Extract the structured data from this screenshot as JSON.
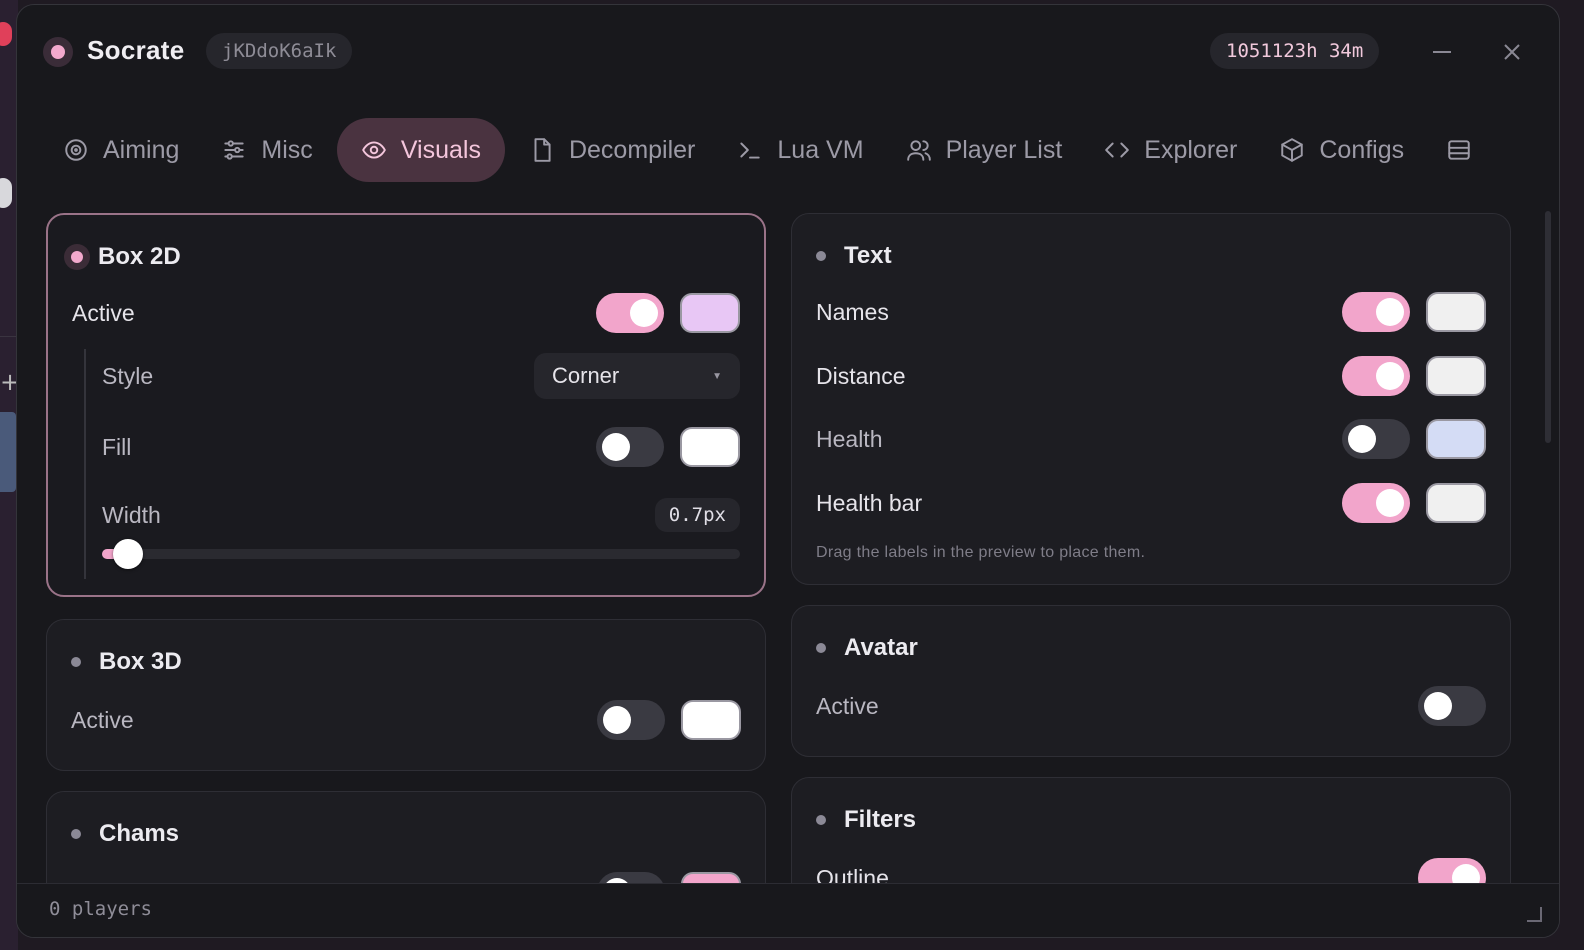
{
  "window": {
    "title": "Socrate",
    "session_id": "jKDdoK6aIk",
    "timer": "1051123h 34m",
    "minimize_glyph": "—",
    "close_glyph": "✕"
  },
  "tabs": [
    {
      "label": "Aiming",
      "icon": "target-icon"
    },
    {
      "label": "Misc",
      "icon": "sliders-icon"
    },
    {
      "label": "Visuals",
      "icon": "eye-icon",
      "active": true
    },
    {
      "label": "Decompiler",
      "icon": "file-icon"
    },
    {
      "label": "Lua VM",
      "icon": "terminal-icon"
    },
    {
      "label": "Player List",
      "icon": "users-icon"
    },
    {
      "label": "Explorer",
      "icon": "code-icon"
    },
    {
      "label": "Configs",
      "icon": "box-icon"
    }
  ],
  "box2d": {
    "title": "Box 2D",
    "active_label": "Active",
    "active_on": true,
    "active_color": "#e8c7f5",
    "style_label": "Style",
    "style_value": "Corner",
    "fill_label": "Fill",
    "fill_on": false,
    "fill_color": "#ffffff",
    "width_label": "Width",
    "width_value": "0.7px",
    "width_fraction": 0.04
  },
  "box3d": {
    "title": "Box 3D",
    "active_label": "Active",
    "active_on": false,
    "active_color": "#ffffff"
  },
  "chams": {
    "title": "Chams",
    "active_color": "#f2a5cb"
  },
  "text": {
    "title": "Text",
    "rows": [
      {
        "label": "Names",
        "on": true,
        "color": "#f0f0f0"
      },
      {
        "label": "Distance",
        "on": true,
        "color": "#f0f0f0"
      },
      {
        "label": "Health",
        "on": false,
        "color": "#d4dcf5"
      },
      {
        "label": "Health bar",
        "on": true,
        "color": "#f0f0f0"
      }
    ],
    "hint": "Drag the labels in the preview to place them."
  },
  "avatar": {
    "title": "Avatar",
    "active_label": "Active",
    "active_on": false
  },
  "filters": {
    "title": "Filters",
    "outline_label": "Outline",
    "outline_on": true
  },
  "footer": {
    "status": "0 players"
  },
  "colors": {
    "accent": "#f2a5cb",
    "active_tab_bg": "#4a3340"
  }
}
